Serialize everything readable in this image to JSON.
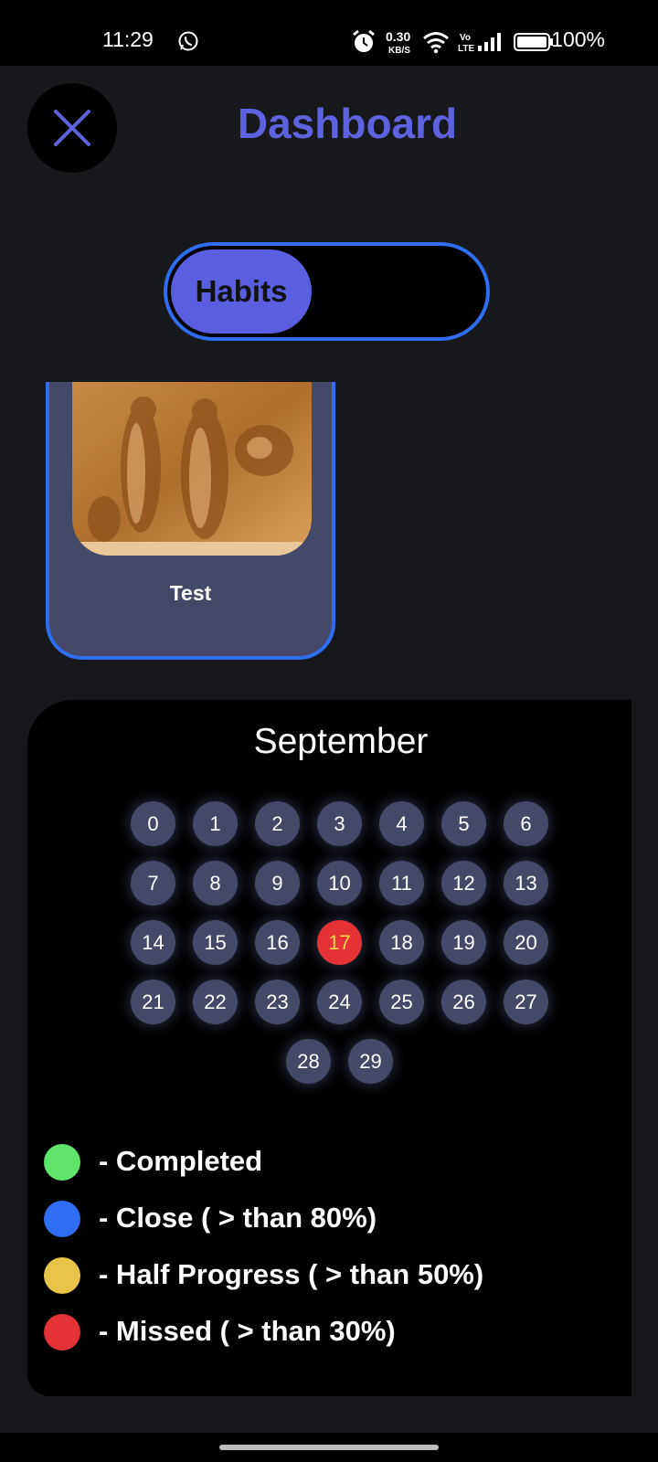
{
  "status_bar": {
    "time": "11:29",
    "speed_value": "0.30",
    "speed_unit": "KB/S",
    "volte_top": "Vo",
    "volte_bottom": "LTE",
    "battery": "100%"
  },
  "header": {
    "title": "Dashboard",
    "close_icon": "close-icon"
  },
  "toggle": {
    "selected_label": "Habits"
  },
  "habit_card": {
    "name": "Test"
  },
  "calendar": {
    "month": "September",
    "rows": [
      [
        "0",
        "1",
        "2",
        "3",
        "4",
        "5",
        "6"
      ],
      [
        "7",
        "8",
        "9",
        "10",
        "11",
        "12",
        "13"
      ],
      [
        "14",
        "15",
        "16",
        "17",
        "18",
        "19",
        "20"
      ],
      [
        "21",
        "22",
        "23",
        "24",
        "25",
        "26",
        "27"
      ],
      [
        "28",
        "29"
      ]
    ],
    "missed_days": [
      "17"
    ],
    "day_color": "#44496a",
    "missed_color": "#e53236"
  },
  "legend": [
    {
      "color": "#5ee56a",
      "label": "- Completed"
    },
    {
      "color": "#2f6df1",
      "label": "- Close ( > than 80%)"
    },
    {
      "color": "#e8c44a",
      "label": "- Half Progress ( > than 50%)"
    },
    {
      "color": "#e53236",
      "label": "- Missed ( > than 30%)"
    }
  ],
  "colors": {
    "accent": "#5f62de",
    "border": "#2f6df1",
    "background": "#17181c"
  }
}
